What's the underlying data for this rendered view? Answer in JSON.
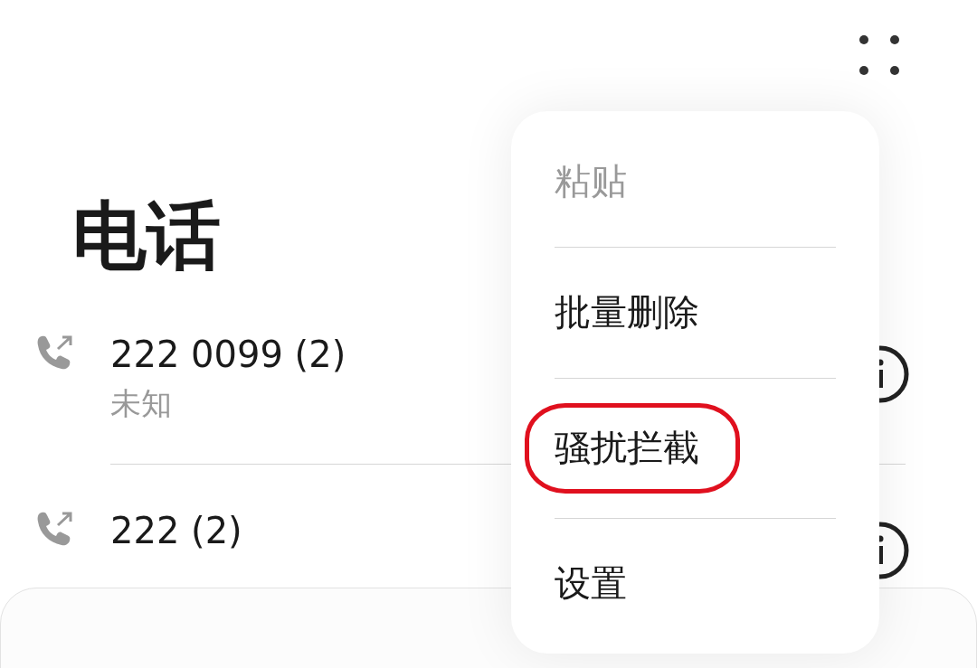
{
  "title": "电话",
  "calls": [
    {
      "number": "222 0099 (2)",
      "label": "未知"
    },
    {
      "number": "222 (2)"
    }
  ],
  "menu": [
    {
      "label": "粘贴",
      "disabled": true,
      "circled": false
    },
    {
      "label": "批量删除",
      "disabled": false,
      "circled": false
    },
    {
      "label": "骚扰拦截",
      "disabled": false,
      "circled": true
    },
    {
      "label": "设置",
      "disabled": false,
      "circled": false
    }
  ]
}
